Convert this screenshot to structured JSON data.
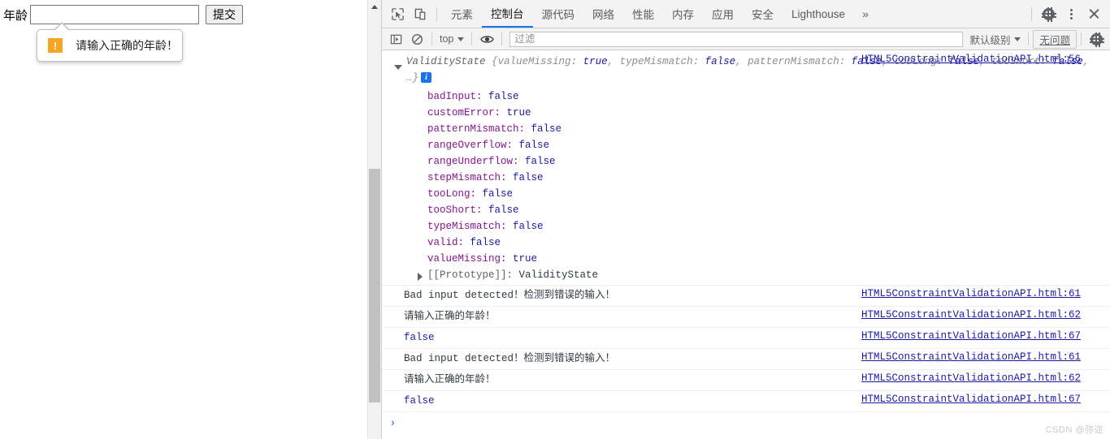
{
  "page": {
    "age_label": "年龄",
    "age_input_value": "",
    "age_input_placeholder": "",
    "submit_label": "提交",
    "validation_bubble": {
      "icon": "warning-exclamation-icon",
      "icon_glyph": "!",
      "icon_color": "#f5a623",
      "message": "请输入正确的年龄！"
    }
  },
  "devtools": {
    "tabbar": {
      "inspect_icon": "inspect-element-icon",
      "device_icon": "device-toolbar-icon",
      "tabs": [
        {
          "label": "元素",
          "active": false
        },
        {
          "label": "控制台",
          "active": true
        },
        {
          "label": "源代码",
          "active": false
        },
        {
          "label": "网络",
          "active": false
        },
        {
          "label": "性能",
          "active": false
        },
        {
          "label": "内存",
          "active": false
        },
        {
          "label": "应用",
          "active": false
        },
        {
          "label": "安全",
          "active": false
        },
        {
          "label": "Lighthouse",
          "active": false
        }
      ],
      "more_tabs": "»",
      "settings_icon": "gear-icon",
      "more_options_icon": "kebab-menu-icon",
      "close_icon": "close-icon",
      "active_tab_accent": "#1a73e8"
    },
    "console_toolbar": {
      "sidebar_toggle_icon": "console-sidebar-icon",
      "clear_icon": "clear-console-icon",
      "context": "top",
      "eye_icon": "live-expression-icon",
      "filter_placeholder": "过滤",
      "filter_value": "",
      "level": "默认级别",
      "issues_label": "无问题",
      "settings_icon": "gear-icon"
    },
    "console": {
      "object_entry": {
        "source_link": "HTML5ConstraintValidationAPI.html:56",
        "class_name": "ValidityState",
        "preview_parts": [
          {
            "text": " {",
            "kind": "punc"
          },
          {
            "text": "valueMissing",
            "kind": "prop"
          },
          {
            "text": ": ",
            "kind": "punc"
          },
          {
            "text": "true",
            "kind": "bool"
          },
          {
            "text": ", ",
            "kind": "punc"
          },
          {
            "text": "typeMismatch",
            "kind": "prop"
          },
          {
            "text": ": ",
            "kind": "punc"
          },
          {
            "text": "false",
            "kind": "bool"
          },
          {
            "text": ", ",
            "kind": "punc"
          },
          {
            "text": "patternMismatch",
            "kind": "prop"
          },
          {
            "text": ": ",
            "kind": "punc"
          },
          {
            "text": "false",
            "kind": "bool"
          },
          {
            "text": ", ",
            "kind": "punc"
          },
          {
            "text": "tooLong",
            "kind": "prop"
          },
          {
            "text": ": ",
            "kind": "punc"
          },
          {
            "text": "false",
            "kind": "bool"
          },
          {
            "text": ", ",
            "kind": "punc"
          },
          {
            "text": "tooShort",
            "kind": "prop"
          },
          {
            "text": ": ",
            "kind": "punc"
          },
          {
            "text": "false",
            "kind": "bool"
          },
          {
            "text": ", …}",
            "kind": "punc"
          }
        ],
        "info_badge": "i",
        "properties": [
          {
            "key": "badInput",
            "value": "false"
          },
          {
            "key": "customError",
            "value": "true"
          },
          {
            "key": "patternMismatch",
            "value": "false"
          },
          {
            "key": "rangeOverflow",
            "value": "false"
          },
          {
            "key": "rangeUnderflow",
            "value": "false"
          },
          {
            "key": "stepMismatch",
            "value": "false"
          },
          {
            "key": "tooLong",
            "value": "false"
          },
          {
            "key": "tooShort",
            "value": "false"
          },
          {
            "key": "typeMismatch",
            "value": "false"
          },
          {
            "key": "valid",
            "value": "false"
          },
          {
            "key": "valueMissing",
            "value": "true"
          }
        ],
        "prototype_key": "[[Prototype]]",
        "prototype_value": "ValidityState"
      },
      "messages": [
        {
          "text": "Bad input detected！检测到错误的输入！",
          "link": "HTML5ConstraintValidationAPI.html:61",
          "kind": "text"
        },
        {
          "text": "请输入正确的年龄！",
          "link": "HTML5ConstraintValidationAPI.html:62",
          "kind": "text"
        },
        {
          "text": "false",
          "link": "HTML5ConstraintValidationAPI.html:67",
          "kind": "bool"
        },
        {
          "text": "Bad input detected！检测到错误的输入！",
          "link": "HTML5ConstraintValidationAPI.html:61",
          "kind": "text"
        },
        {
          "text": "请输入正确的年龄！",
          "link": "HTML5ConstraintValidationAPI.html:62",
          "kind": "text"
        },
        {
          "text": "false",
          "link": "HTML5ConstraintValidationAPI.html:67",
          "kind": "bool"
        }
      ],
      "prompt_caret": "›"
    }
  },
  "watermark": "CSDN @弥迩"
}
